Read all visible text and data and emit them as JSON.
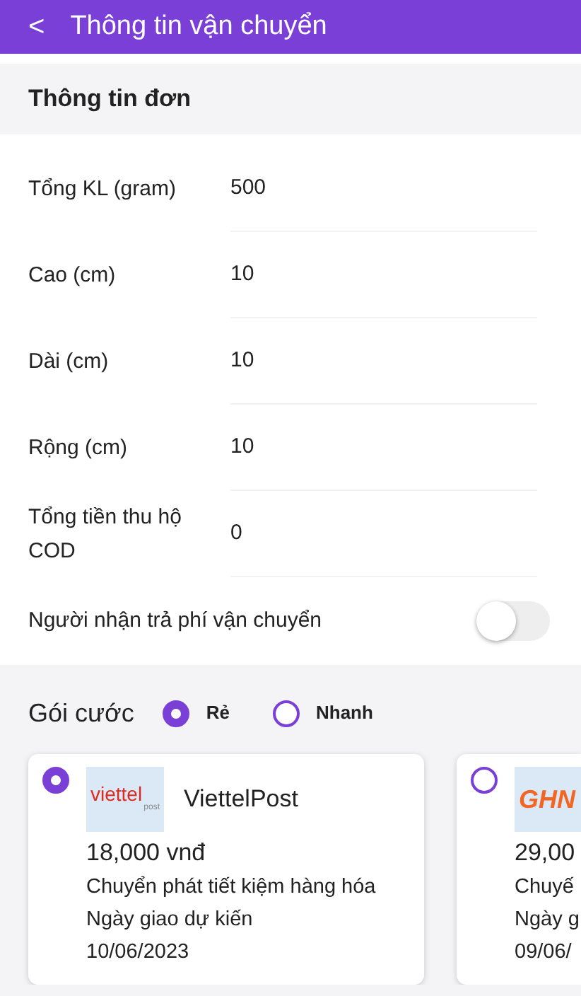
{
  "header": {
    "back": "<",
    "title": "Thông tin vận chuyển"
  },
  "order_section": {
    "title": "Thông tin đơn",
    "fields": [
      {
        "label": "Tổng KL (gram)",
        "value": "500"
      },
      {
        "label": "Cao (cm)",
        "value": "10"
      },
      {
        "label": "Dài (cm)",
        "value": "10"
      },
      {
        "label": "Rộng (cm)",
        "value": "10"
      },
      {
        "label": "Tổng tiền thu hộ COD",
        "value": "0"
      }
    ],
    "toggle": {
      "label": "Người nhận trả phí vận chuyển",
      "on": false
    }
  },
  "plan_section": {
    "title": "Gói cước",
    "options": [
      {
        "label": "Rẻ",
        "selected": true
      },
      {
        "label": "Nhanh",
        "selected": false
      }
    ],
    "carriers": [
      {
        "selected": true,
        "logo": "viettel",
        "logo_sub": "post",
        "kind": "viettel",
        "name": "ViettelPost",
        "price": "18,000 vnđ",
        "service": "Chuyển phát tiết kiệm hàng hóa",
        "eta_label": "Ngày giao dự kiến",
        "eta": "10/06/2023"
      },
      {
        "selected": false,
        "logo": "GHN",
        "kind": "ghn",
        "price": "29,00",
        "service": "Chuyế",
        "eta_label": "Ngày g",
        "eta": "09/06/"
      }
    ]
  }
}
